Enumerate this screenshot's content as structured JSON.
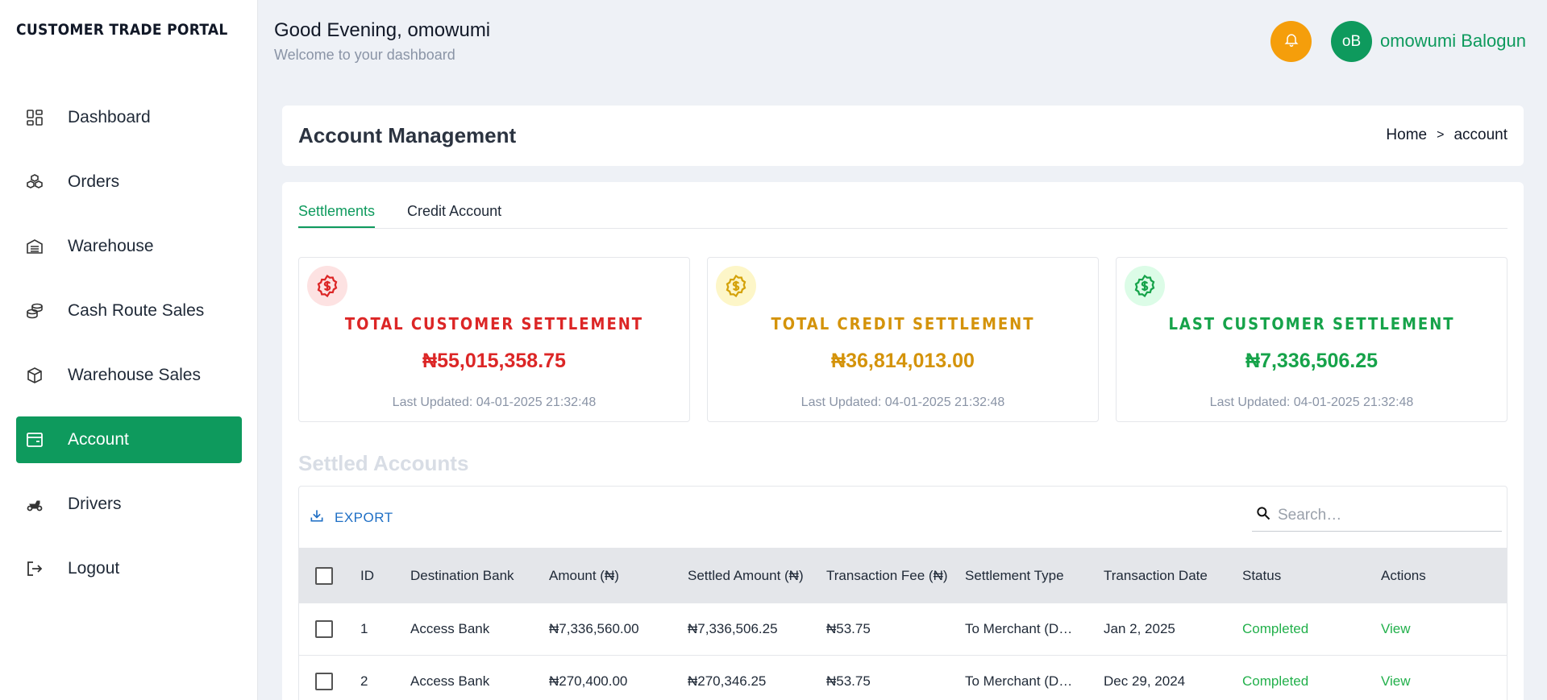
{
  "app": {
    "brand": "CUSTOMER TRADE PORTAL"
  },
  "sidebar": {
    "items": [
      {
        "label": "Dashboard",
        "icon": "dashboard-icon",
        "active": false
      },
      {
        "label": "Orders",
        "icon": "boxes-icon",
        "active": false
      },
      {
        "label": "Warehouse",
        "icon": "warehouse-icon",
        "active": false
      },
      {
        "label": "Cash Route Sales",
        "icon": "coins-icon",
        "active": false
      },
      {
        "label": "Warehouse Sales",
        "icon": "package-icon",
        "active": false
      },
      {
        "label": "Account",
        "icon": "wallet-icon",
        "active": true
      },
      {
        "label": "Drivers",
        "icon": "scooter-icon",
        "active": false
      },
      {
        "label": "Logout",
        "icon": "logout-icon",
        "active": false
      }
    ]
  },
  "header": {
    "greeting": "Good Evening, omowumi",
    "welcome": "Welcome to your dashboard",
    "avatar_initials": "oB",
    "user_name": "omowumi Balogun"
  },
  "page": {
    "title": "Account Management",
    "breadcrumb": {
      "home": "Home",
      "sep": ">",
      "current": "account"
    }
  },
  "tabs": [
    {
      "label": "Settlements",
      "active": true
    },
    {
      "label": "Credit Account",
      "active": false
    }
  ],
  "stats": [
    {
      "title": "TOTAL CUSTOMER SETTLEMENT",
      "value": "₦55,015,358.75",
      "updated": "Last Updated: 04-01-2025 21:32:48",
      "color": "#dc2626",
      "icon_bg": "#fde2e2"
    },
    {
      "title": "TOTAL CREDIT SETTLEMENT",
      "value": "₦36,814,013.00",
      "updated": "Last Updated: 04-01-2025 21:32:48",
      "color": "#d4930a",
      "icon_bg": "#fdf6c8"
    },
    {
      "title": "LAST CUSTOMER SETTLEMENT",
      "value": "₦7,336,506.25",
      "updated": "Last Updated: 04-01-2025 21:32:48",
      "color": "#16a34a",
      "icon_bg": "#dcfce7"
    }
  ],
  "settled": {
    "title": "Settled Accounts",
    "export_label": "EXPORT",
    "search_placeholder": "Search…",
    "columns": [
      "ID",
      "Destination Bank",
      "Amount (₦)",
      "Settled Amount (₦)",
      "Transaction Fee (₦)",
      "Settlement Type",
      "Transaction Date",
      "Status",
      "Actions"
    ],
    "rows": [
      {
        "id": "1",
        "bank": "Access Bank",
        "amount": "₦7,336,560.00",
        "settled": "₦7,336,506.25",
        "fee": "₦53.75",
        "type": "To Merchant (D…",
        "date": "Jan 2, 2025",
        "status": "Completed",
        "action": "View"
      },
      {
        "id": "2",
        "bank": "Access Bank",
        "amount": "₦270,400.00",
        "settled": "₦270,346.25",
        "fee": "₦53.75",
        "type": "To Merchant (D…",
        "date": "Dec 29, 2024",
        "status": "Completed",
        "action": "View"
      }
    ]
  },
  "colors": {
    "primary": "#0e9a5d",
    "bell": "#f59e0b",
    "link": "#1f6fc5"
  }
}
